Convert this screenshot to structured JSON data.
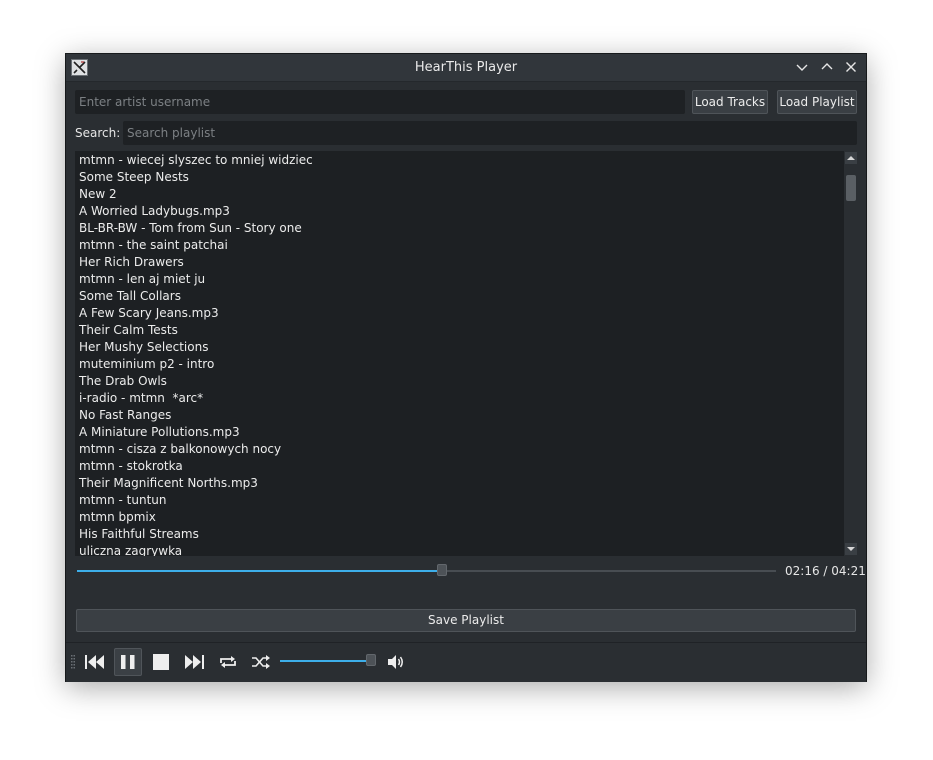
{
  "window": {
    "title": "HearThis Player"
  },
  "controls": {
    "username_placeholder": "Enter artist username",
    "load_tracks_label": "Load Tracks",
    "load_playlist_label": "Load Playlist",
    "search_label": "Search:",
    "search_placeholder": "Search playlist"
  },
  "playlist": {
    "tracks": [
      "mtmn - wiecej slyszec to mniej widziec",
      "Some Steep Nests",
      "New 2",
      "A Worried Ladybugs.mp3",
      "BL-BR-BW - Tom from Sun - Story one",
      "mtmn - the saint patchai",
      "Her Rich Drawers",
      "mtmn - len aj miet ju",
      "Some Tall Collars",
      "A Few Scary Jeans.mp3",
      "Their Calm Tests",
      "Her Mushy Selections",
      "muteminium p2 - intro",
      "The Drab Owls",
      "i-radio - mtmn  *arc*",
      "No Fast Ranges",
      "A Miniature Pollutions.mp3",
      "mtmn - cisza z balkonowych nocy",
      "mtmn - stokrotka",
      "Their Magnificent Norths.mp3",
      "mtmn - tuntun",
      "mtmn bpmix",
      "His Faithful Streams",
      "uliczna zagrywka"
    ]
  },
  "playback": {
    "time_text": "02:16 / 04:21",
    "progress_fraction": 0.521,
    "volume_fraction": 1.0,
    "state": "playing"
  },
  "save_label": "Save Playlist",
  "colors": {
    "accent": "#3daee9",
    "window_bg": "#2a2e32",
    "list_bg": "#1d2023"
  },
  "icons": [
    "app-icon",
    "minimize-icon",
    "maximize-icon",
    "close-icon",
    "previous-icon",
    "pause-icon",
    "stop-icon",
    "next-icon",
    "repeat-icon",
    "shuffle-icon",
    "volume-icon"
  ]
}
